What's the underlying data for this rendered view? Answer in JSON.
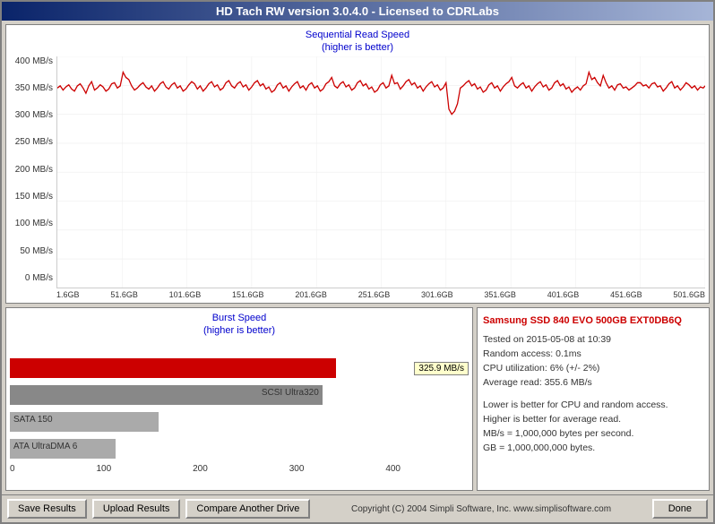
{
  "window": {
    "title": "HD Tach RW version 3.0.4.0 - Licensed to CDRLabs"
  },
  "seq_chart": {
    "title_line1": "Sequential Read Speed",
    "title_line2": "(higher is better)",
    "y_axis": [
      "400 MB/s",
      "350 MB/s",
      "300 MB/s",
      "250 MB/s",
      "200 MB/s",
      "150 MB/s",
      "100 MB/s",
      "50 MB/s",
      "0 MB/s"
    ],
    "x_axis": [
      "1.6GB",
      "51.6GB",
      "101.6GB",
      "151.6GB",
      "201.6GB",
      "251.6GB",
      "301.6GB",
      "351.6GB",
      "401.6GB",
      "451.6GB",
      "501.6GB"
    ]
  },
  "burst_chart": {
    "title_line1": "Burst Speed",
    "title_line2": "(higher is better)",
    "bars": [
      {
        "label": "",
        "value": "325.9 MB/s",
        "color": "#cc0000",
        "width_pct": 82
      },
      {
        "label": "SCSI Ultra320",
        "value": "",
        "color": "#888888",
        "width_pct": 80
      },
      {
        "label": "SATA 150",
        "value": "",
        "color": "#888888",
        "width_pct": 38
      },
      {
        "label": "ATA UltraDMA 6",
        "value": "",
        "color": "#888888",
        "width_pct": 27
      }
    ],
    "x_axis": [
      "0",
      "100",
      "200",
      "300",
      "400"
    ]
  },
  "info_panel": {
    "drive_name": "Samsung SSD 840 EVO 500GB EXT0DB6Q",
    "line1": "Tested on 2015-05-08 at 10:39",
    "line2": "Random access: 0.1ms",
    "line3": "CPU utilization: 6% (+/- 2%)",
    "line4": "Average read: 355.6 MB/s",
    "line5": "",
    "line6": "Lower is better for CPU and random access.",
    "line7": "Higher is better for average read.",
    "line8": "MB/s = 1,000,000 bytes per second.",
    "line9": "GB = 1,000,000,000 bytes."
  },
  "footer": {
    "save_btn": "Save Results",
    "upload_btn": "Upload Results",
    "compare_btn": "Compare Another Drive",
    "copyright": "Copyright (C) 2004 Simpli Software, Inc. www.simplisoftware.com",
    "done_btn": "Done"
  }
}
